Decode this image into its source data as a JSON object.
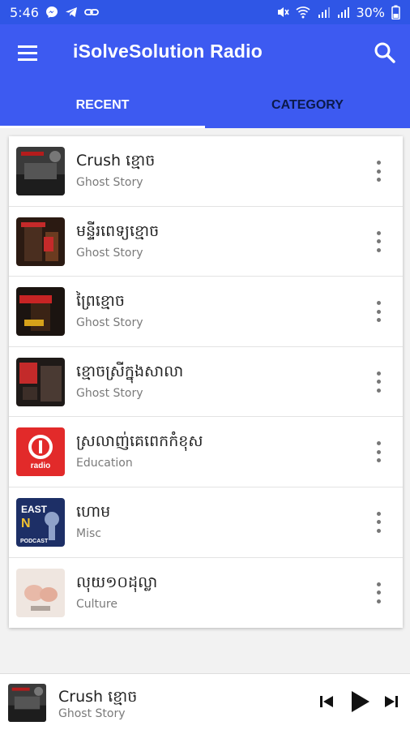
{
  "status_bar": {
    "time": "5:46",
    "battery": "30%",
    "left_icons": [
      "messenger-icon",
      "telegram-icon",
      "link-icon"
    ],
    "right_icons": [
      "mute-icon",
      "wifi-icon",
      "signal-icon",
      "signal-icon",
      "battery-icon"
    ]
  },
  "app_bar": {
    "title": "iSolveSolution Radio",
    "menu_icon": "menu-icon",
    "search_icon": "search-icon"
  },
  "tabs": [
    {
      "label": "RECENT",
      "active": true
    },
    {
      "label": "CATEGORY",
      "active": false
    }
  ],
  "items": [
    {
      "title": "Crush ខ្មោច",
      "subtitle": "Ghost Story"
    },
    {
      "title": "មន្ទីរពេទ្យខ្មោច",
      "subtitle": "Ghost Story"
    },
    {
      "title": "ព្រៃខ្មោច",
      "subtitle": "Ghost Story"
    },
    {
      "title": "ខ្មោចស្រីក្នុងសាលា",
      "subtitle": "Ghost Story"
    },
    {
      "title": "ស្រលាញ់គេពេកកំខុស",
      "subtitle": "Education"
    },
    {
      "title": "ហោម",
      "subtitle": "Misc"
    },
    {
      "title": "លុយ១០ដុល្លា",
      "subtitle": "Culture"
    }
  ],
  "thumb_texts": {
    "radio_logo": "radio",
    "podcast_top": "EAST",
    "podcast_mid": "N",
    "podcast_bottom": "PODCAST"
  },
  "player": {
    "title": "Crush ខ្មោច",
    "subtitle": "Ghost Story",
    "controls": [
      "skip-previous-icon",
      "play-icon",
      "skip-next-icon"
    ]
  },
  "colors": {
    "status_bar": "#2f56e6",
    "app_bar": "#3d5af1",
    "inactive_tab": "#0b1a4a"
  }
}
